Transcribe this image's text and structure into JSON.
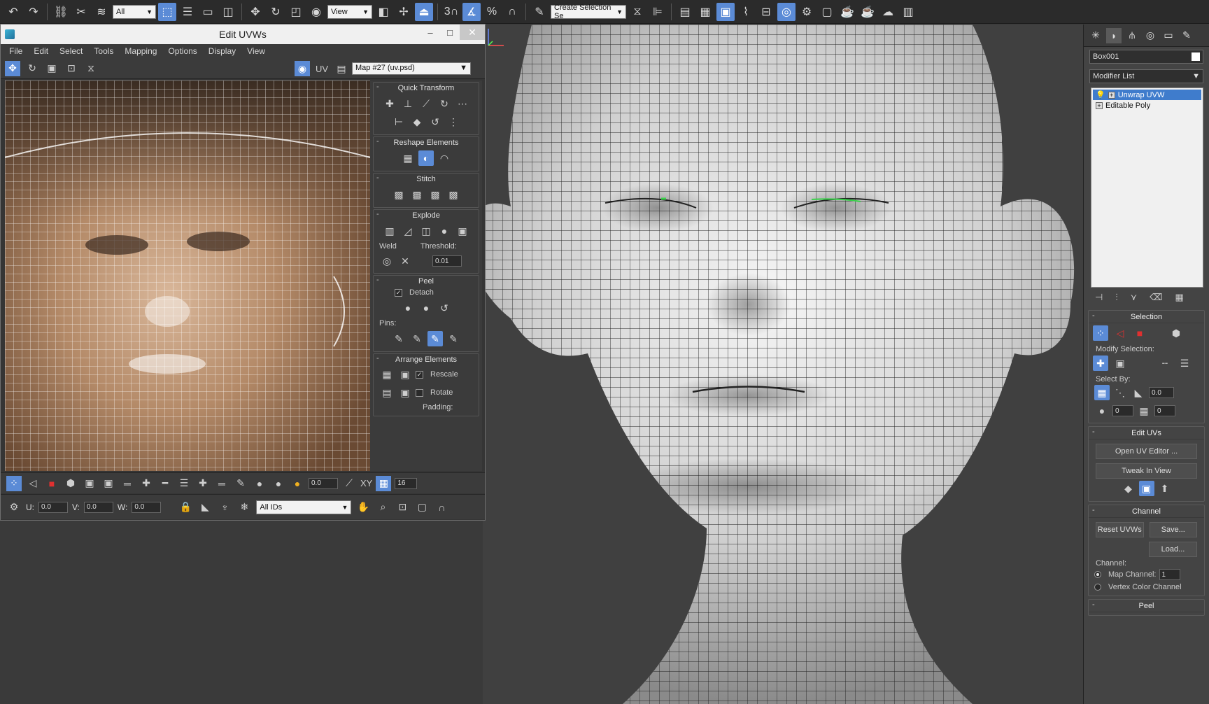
{
  "toolbar": {
    "selection_filter": "All",
    "reference_coord": "View",
    "selection_set_placeholder": "Create Selection Se",
    "snap_labels": {
      "snap": "3",
      "angle": "",
      "percent": "%"
    }
  },
  "uvw_window": {
    "title": "Edit UVWs",
    "menu": [
      "File",
      "Edit",
      "Select",
      "Tools",
      "Mapping",
      "Options",
      "Display",
      "View"
    ],
    "uv_label": "UV",
    "map_select": "Map #27 (uv.psd)",
    "panel": {
      "quick_transform": "Quick Transform",
      "reshape_elements": "Reshape Elements",
      "stitch": "Stitch",
      "explode": "Explode",
      "weld": "Weld",
      "threshold_label": "Threshold:",
      "threshold_value": "0.01",
      "peel": "Peel",
      "detach": "Detach",
      "pins": "Pins:",
      "arrange_elements": "Arrange Elements",
      "rescale": "Rescale",
      "rotate": "Rotate",
      "padding": "Padding:"
    },
    "bottom": {
      "soft_value": "0.0",
      "xy_label": "XY",
      "grid_value": "16",
      "u_label": "U:",
      "u_value": "0.0",
      "v_label": "V:",
      "v_value": "0.0",
      "w_label": "W:",
      "w_value": "0.0",
      "ids_select": "All IDs"
    }
  },
  "command_panel": {
    "object_name": "Box001",
    "modifier_list": "Modifier List",
    "stack": [
      {
        "label": "Unwrap UVW",
        "selected": true
      },
      {
        "label": "Editable Poly",
        "selected": false
      }
    ],
    "selection": {
      "title": "Selection",
      "modify_selection": "Modify Selection:",
      "select_by": "Select By:",
      "angle_value": "0.0",
      "spin_a": "0",
      "spin_b": "0"
    },
    "edit_uvs": {
      "title": "Edit UVs",
      "open_editor": "Open UV Editor ...",
      "tweak": "Tweak In View"
    },
    "channel": {
      "title": "Channel",
      "reset": "Reset UVWs",
      "save": "Save...",
      "load": "Load...",
      "channel_label": "Channel:",
      "map_channel": "Map Channel:",
      "map_channel_value": "1",
      "vertex_color": "Vertex Color Channel"
    },
    "peel": {
      "title": "Peel"
    }
  },
  "colors": {
    "accent": "#5b8bd6",
    "stack_selected": "#3f7ccc",
    "viewport_bg": "#404040"
  }
}
